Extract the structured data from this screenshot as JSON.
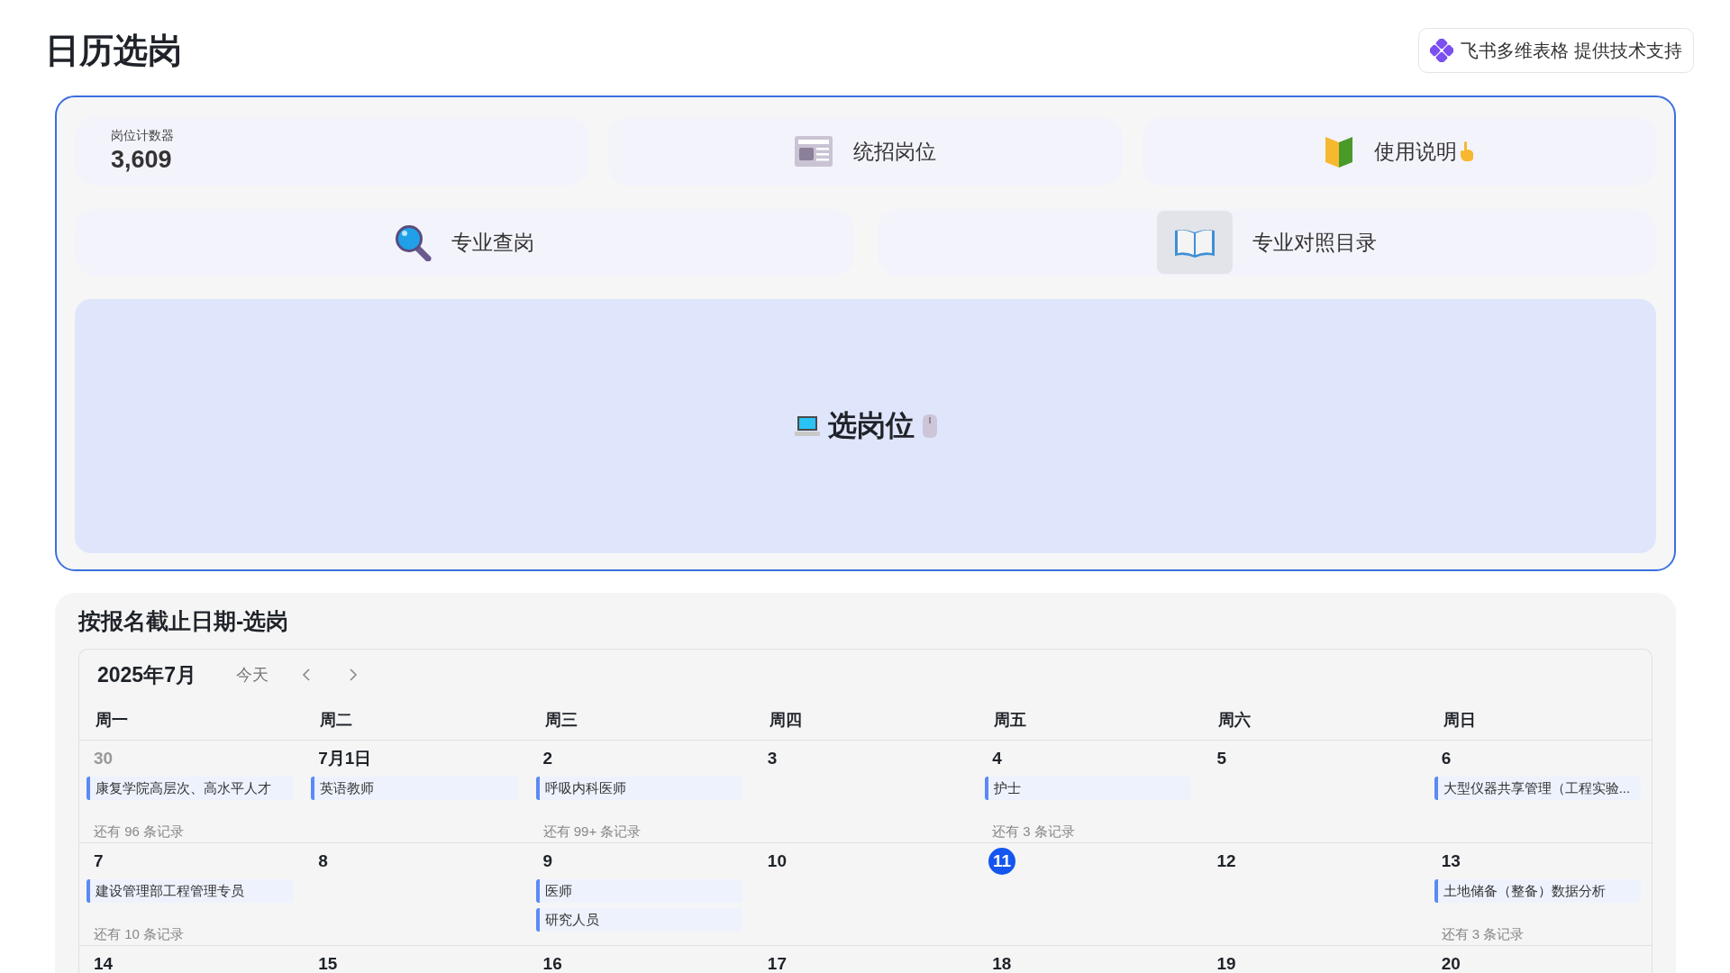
{
  "page_title": "日历选岗",
  "badge": {
    "text": "飞书多维表格 提供技术支持"
  },
  "dashboard": {
    "counter": {
      "label": "岗位计数器",
      "value": "3,609"
    },
    "top_buttons": [
      {
        "kind": "newspaper",
        "label": "统招岗位"
      },
      {
        "kind": "guide",
        "label": "使用说明"
      }
    ],
    "middle_buttons": [
      {
        "kind": "search",
        "label": "专业查岗"
      },
      {
        "kind": "book",
        "label": "专业对照目录"
      }
    ],
    "main_button": {
      "label": "选岗位"
    }
  },
  "calendar": {
    "title": "按报名截止日期-选岗",
    "month": "2025年7月",
    "today_button": "今天",
    "weekdays": [
      "周一",
      "周二",
      "周三",
      "周四",
      "周五",
      "周六",
      "周日"
    ],
    "weeks": [
      [
        {
          "date": "30",
          "outside_month": true,
          "today": false,
          "events": [
            "康复学院高层次、高水平人才"
          ],
          "more": "还有 96 条记录"
        },
        {
          "date": "7月1日",
          "outside_month": false,
          "today": false,
          "events": [
            "英语教师"
          ]
        },
        {
          "date": "2",
          "outside_month": false,
          "today": false,
          "events": [
            "呼吸内科医师"
          ],
          "more": "还有 99+ 条记录"
        },
        {
          "date": "3",
          "outside_month": false,
          "today": false
        },
        {
          "date": "4",
          "outside_month": false,
          "today": false,
          "events": [
            "护士"
          ],
          "more": "还有 3 条记录"
        },
        {
          "date": "5",
          "outside_month": false,
          "today": false
        },
        {
          "date": "6",
          "outside_month": false,
          "today": false,
          "events": [
            "大型仪器共享管理（工程实验..."
          ]
        }
      ],
      [
        {
          "date": "7",
          "outside_month": false,
          "today": false,
          "events": [
            "建设管理部工程管理专员"
          ],
          "more": "还有 10 条记录"
        },
        {
          "date": "8",
          "outside_month": false,
          "today": false
        },
        {
          "date": "9",
          "outside_month": false,
          "today": false,
          "events": [
            "医师",
            "研究人员"
          ]
        },
        {
          "date": "10",
          "outside_month": false,
          "today": false
        },
        {
          "date": "11",
          "outside_month": false,
          "today": true
        },
        {
          "date": "12",
          "outside_month": false,
          "today": false
        },
        {
          "date": "13",
          "outside_month": false,
          "today": false,
          "events": [
            "土地储备（整备）数据分析"
          ],
          "more": "还有 3 条记录"
        }
      ],
      [
        {
          "date": "14",
          "outside_month": false,
          "today": false
        },
        {
          "date": "15",
          "outside_month": false,
          "today": false
        },
        {
          "date": "16",
          "outside_month": false,
          "today": false
        },
        {
          "date": "17",
          "outside_month": false,
          "today": false
        },
        {
          "date": "18",
          "outside_month": false,
          "today": false
        },
        {
          "date": "19",
          "outside_month": false,
          "today": false
        },
        {
          "date": "20",
          "outside_month": false,
          "today": false
        }
      ]
    ]
  }
}
